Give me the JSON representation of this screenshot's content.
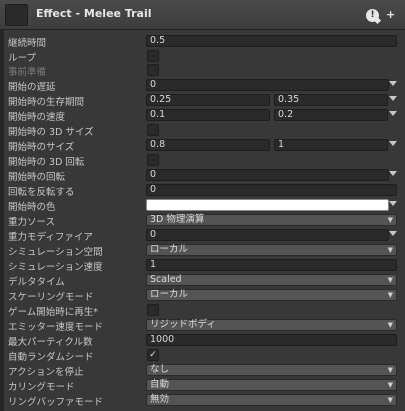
{
  "header": {
    "title": "Effect - Melee Trail",
    "help_glyph": "!",
    "plus_glyph": "+"
  },
  "rows": {
    "duration": {
      "label": "継続時間",
      "value": "0.5"
    },
    "loop": {
      "label": "ループ"
    },
    "prewarm": {
      "label": "事前準備"
    },
    "start_delay": {
      "label": "開始の遅延",
      "value": "0"
    },
    "start_lifetime": {
      "label": "開始時の生存期間",
      "min": "0.25",
      "max": "0.35"
    },
    "start_speed": {
      "label": "開始時の速度",
      "min": "0.1",
      "max": "0.2"
    },
    "start_size_3d": {
      "label": "開始時の 3D サイズ"
    },
    "start_size": {
      "label": "開始時のサイズ",
      "min": "0.8",
      "max": "1"
    },
    "start_rotation_3d": {
      "label": "開始時の 3D 回転"
    },
    "start_rotation": {
      "label": "開始時の回転",
      "value": "0"
    },
    "flip_rotation": {
      "label": "回転を反転する",
      "value": "0"
    },
    "start_color": {
      "label": "開始時の色",
      "color": "#ffffff"
    },
    "gravity_source": {
      "label": "重力ソース",
      "value": "3D 物理演算"
    },
    "gravity_modifier": {
      "label": "重力モディファイア",
      "value": "0"
    },
    "simulation_space": {
      "label": "シミュレーション空間",
      "value": "ローカル"
    },
    "simulation_speed": {
      "label": "シミュレーション速度",
      "value": "1"
    },
    "delta_time": {
      "label": "デルタタイム",
      "value": "Scaled"
    },
    "scaling_mode": {
      "label": "スケーリングモード",
      "value": "ローカル"
    },
    "play_on_awake": {
      "label": "ゲーム開始時に再生*"
    },
    "emitter_velocity": {
      "label": "エミッター速度モード",
      "value": "リジッドボディ"
    },
    "max_particles": {
      "label": "最大パーティクル数",
      "value": "1000"
    },
    "auto_random_seed": {
      "label": "自動ランダムシード",
      "checked": "✓"
    },
    "stop_action": {
      "label": "アクションを停止",
      "value": "なし"
    },
    "culling_mode": {
      "label": "カリングモード",
      "value": "自動"
    },
    "ring_buffer": {
      "label": "リングバッファモード",
      "value": "無効"
    }
  }
}
